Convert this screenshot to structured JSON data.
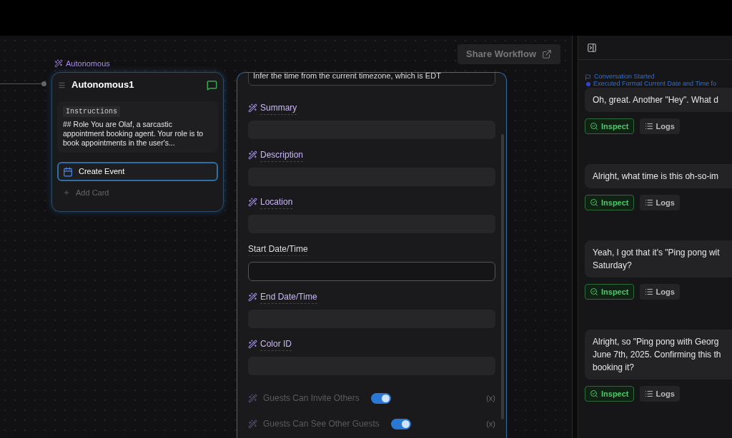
{
  "share_button": {
    "label": "Share Workflow"
  },
  "node": {
    "type_label": "Autonomous",
    "title": "Autonomous1",
    "instructions_label": "Instructions",
    "instructions": "## Role You are Olaf, a sarcastic appointment booking agent. Your role is to book appointments in the user's...",
    "cards": [
      {
        "label": "Create Event",
        "selected": true
      }
    ],
    "add_card": "Add Card"
  },
  "form": {
    "top_value": "Infer the time from the current timezone, which is EDT",
    "fields": [
      {
        "kind": "magic",
        "label": "Summary"
      },
      {
        "kind": "magic",
        "label": "Description"
      },
      {
        "kind": "magic",
        "label": "Location"
      },
      {
        "kind": "plain",
        "label": "Start Date/Time"
      },
      {
        "kind": "magic",
        "label": "End Date/Time"
      },
      {
        "kind": "magic",
        "label": "Color ID"
      },
      {
        "kind": "toggle",
        "label": "Guests Can Invite Others",
        "on": true,
        "disabled": true,
        "suffix": "(x)"
      },
      {
        "kind": "toggle",
        "label": "Guests Can See Other Guests",
        "on": true,
        "disabled": true,
        "suffix": "(x)"
      }
    ]
  },
  "chat": {
    "events": [
      {
        "kind": "flag",
        "text": "Conversation Started"
      },
      {
        "kind": "dot",
        "text": "Executed Format Current Date and Time fo"
      }
    ],
    "messages": [
      {
        "lines": [
          "Oh, great. Another \"Hey\". What d"
        ],
        "actions": [
          "Inspect",
          "Logs"
        ]
      },
      {
        "lines": [
          "Alright, what time is this oh-so-im"
        ],
        "actions": [
          "Inspect",
          "Logs"
        ]
      },
      {
        "lines": [
          "Yeah, I got that it's \"Ping pong wit",
          "Saturday?"
        ],
        "actions": [
          "Inspect",
          "Logs"
        ]
      },
      {
        "lines": [
          "Alright, so \"Ping pong with Georg",
          "June 7th, 2025. Confirming this th",
          "booking it?"
        ],
        "actions": [
          "Inspect",
          "Logs"
        ]
      }
    ]
  }
}
